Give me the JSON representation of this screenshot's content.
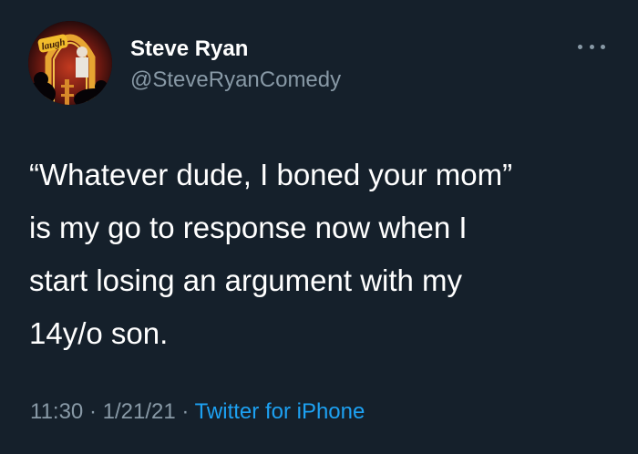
{
  "author": {
    "name": "Steve Ryan",
    "handle": "@SteveRyanComedy",
    "avatar_sign_text": "laugh",
    "avatar_icon": "comedy-club-stage-photo"
  },
  "more_icon": "ellipsis-icon",
  "tweet": {
    "lines": [
      "“Whatever dude, I boned your mom”",
      "is my go to response now when I",
      "start losing an argument with my",
      "14y/o son."
    ]
  },
  "meta": {
    "time": "11:30",
    "separator": " · ",
    "date": "1/21/21",
    "source": "Twitter for iPhone"
  },
  "colors": {
    "background": "#15202b",
    "primary_text": "#ffffff",
    "secondary_text": "#8899a6",
    "link": "#1da1f2"
  }
}
